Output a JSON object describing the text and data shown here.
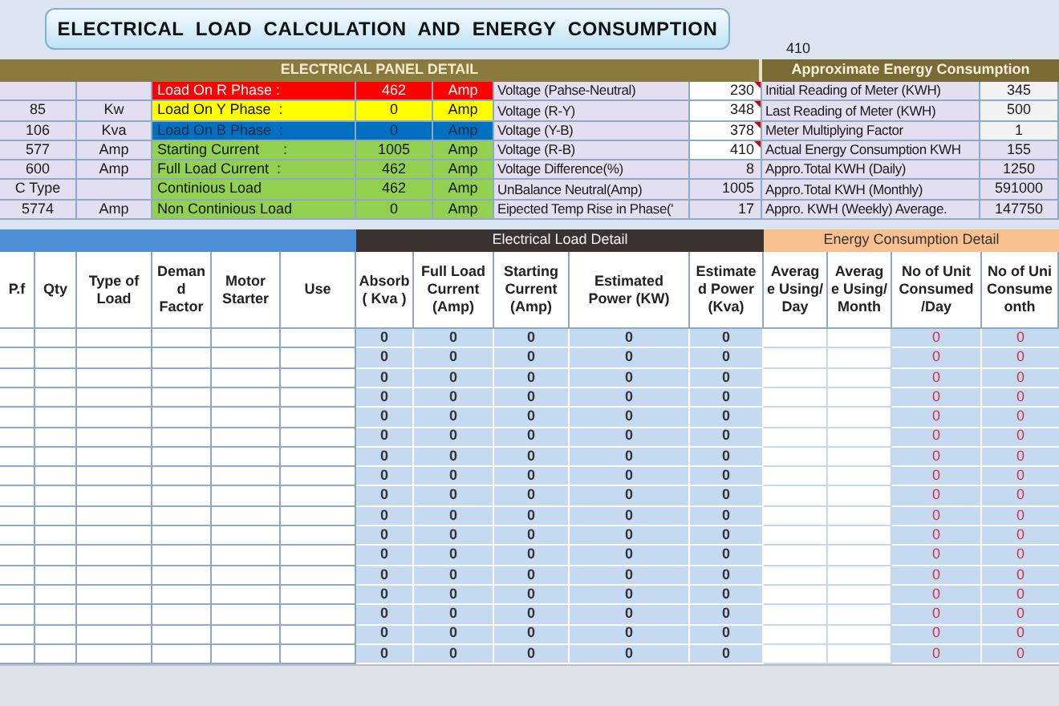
{
  "title": "ELECTRICAL  LOAD  CALCULATION  AND  ENERGY  CONSUMPTION",
  "floating_value": "410",
  "panel": {
    "heading": "ELECTRICAL PANEL DETAIL",
    "energy_heading": "Approximate Energy Consumption",
    "rows": [
      {
        "col_a": null,
        "col_b": null,
        "label": "Load On R Phase :",
        "value": "462",
        "unit": "Amp",
        "color": "#ff0000",
        "voltage_label": "Voltage (Pahse-Neutral)",
        "voltage_value": "230",
        "voltage_input": true,
        "energy_label": "Initial Reading of Meter (KWH)",
        "energy_value": "345",
        "energy_input": true
      },
      {
        "col_a": "85",
        "col_b": "Kw",
        "label": "Load On Y Phase  :",
        "value": "0",
        "unit": "Amp",
        "color": "#ffff00",
        "voltage_label": "Voltage (R-Y)",
        "voltage_value": "348",
        "voltage_input": true,
        "energy_label": "Last Reading of Meter (KWH)",
        "energy_value": "500",
        "energy_input": true
      },
      {
        "col_a": "106",
        "col_b": "Kva",
        "label": "Load On B Phase  :",
        "value": "0",
        "unit": "Amp",
        "color": "#0070c0",
        "voltage_label": "Voltage (Y-B)",
        "voltage_value": "378",
        "voltage_input": true,
        "energy_label": "Meter Multiplying Factor",
        "energy_value": "1",
        "energy_input": true
      },
      {
        "col_a": "577",
        "col_b": "Amp",
        "label": "Starting Current      :",
        "value": "1005",
        "unit": "Amp",
        "color": "#92d050",
        "voltage_label": "Voltage (R-B)",
        "voltage_value": "410",
        "voltage_input": true,
        "energy_label": "Actual Energy Consumption KWH",
        "energy_value": "155",
        "energy_input": false
      },
      {
        "col_a": "600",
        "col_b": "Amp",
        "label": "Full Load Current  :",
        "value": "462",
        "unit": "Amp",
        "color": "#92d050",
        "voltage_label": "Voltage Difference(%)",
        "voltage_value": "8",
        "voltage_input": false,
        "energy_label": "Appro.Total KWH (Daily)",
        "energy_value": "1250",
        "energy_input": false
      },
      {
        "col_a": "C Type",
        "col_b": null,
        "label": "Continious Load",
        "value": "462",
        "unit": "Amp",
        "color": "#92d050",
        "voltage_label": "UnBalance Neutral(Amp)",
        "voltage_value": "1005",
        "voltage_input": false,
        "energy_label": "Appro.Total KWH (Monthly)",
        "energy_value": "591000",
        "energy_input": false
      },
      {
        "col_a": "5774",
        "col_b": "Amp",
        "label": "Non Continious Load",
        "value": "0",
        "unit": "Amp",
        "color": "#92d050",
        "voltage_label": "Eipected Temp Rise in Phase('",
        "voltage_value": "17",
        "voltage_input": false,
        "energy_label": "Appro. KWH (Weekly) Average.",
        "energy_value": "147750",
        "energy_input": false
      }
    ]
  },
  "table": {
    "group_headings": [
      "Electrical Load Detail",
      "Energy Consumption Detail"
    ],
    "columns": [
      "P.f",
      "Qty",
      "Type of Load",
      "Deman d Factor",
      "Motor Starter",
      "Use",
      "Absorb ( Kva )",
      "Full Load Current (Amp)",
      "Starting Current (Amp)",
      "Estimated Power (KW)",
      "Estimate d Power (Kva)",
      "Averag e Using/ Day",
      "Averag e Using/ Month",
      "No of Unit Consumed /Day",
      "No of Uni Consume onth"
    ],
    "rows": [
      {
        "absorb": "0",
        "full_load": "0",
        "starting": "0",
        "power_kw": "0",
        "power_kva": "0",
        "units_day": "0",
        "units_month": "0"
      },
      {
        "absorb": "0",
        "full_load": "0",
        "starting": "0",
        "power_kw": "0",
        "power_kva": "0",
        "units_day": "0",
        "units_month": "0"
      },
      {
        "absorb": "0",
        "full_load": "0",
        "starting": "0",
        "power_kw": "0",
        "power_kva": "0",
        "units_day": "0",
        "units_month": "0"
      },
      {
        "absorb": "0",
        "full_load": "0",
        "starting": "0",
        "power_kw": "0",
        "power_kva": "0",
        "units_day": "0",
        "units_month": "0"
      },
      {
        "absorb": "0",
        "full_load": "0",
        "starting": "0",
        "power_kw": "0",
        "power_kva": "0",
        "units_day": "0",
        "units_month": "0"
      },
      {
        "absorb": "0",
        "full_load": "0",
        "starting": "0",
        "power_kw": "0",
        "power_kva": "0",
        "units_day": "0",
        "units_month": "0"
      },
      {
        "absorb": "0",
        "full_load": "0",
        "starting": "0",
        "power_kw": "0",
        "power_kva": "0",
        "units_day": "0",
        "units_month": "0"
      },
      {
        "absorb": "0",
        "full_load": "0",
        "starting": "0",
        "power_kw": "0",
        "power_kva": "0",
        "units_day": "0",
        "units_month": "0"
      },
      {
        "absorb": "0",
        "full_load": "0",
        "starting": "0",
        "power_kw": "0",
        "power_kva": "0",
        "units_day": "0",
        "units_month": "0"
      },
      {
        "absorb": "0",
        "full_load": "0",
        "starting": "0",
        "power_kw": "0",
        "power_kva": "0",
        "units_day": "0",
        "units_month": "0"
      },
      {
        "absorb": "0",
        "full_load": "0",
        "starting": "0",
        "power_kw": "0",
        "power_kva": "0",
        "units_day": "0",
        "units_month": "0"
      },
      {
        "absorb": "0",
        "full_load": "0",
        "starting": "0",
        "power_kw": "0",
        "power_kva": "0",
        "units_day": "0",
        "units_month": "0"
      },
      {
        "absorb": "0",
        "full_load": "0",
        "starting": "0",
        "power_kw": "0",
        "power_kva": "0",
        "units_day": "0",
        "units_month": "0"
      },
      {
        "absorb": "0",
        "full_load": "0",
        "starting": "0",
        "power_kw": "0",
        "power_kva": "0",
        "units_day": "0",
        "units_month": "0"
      },
      {
        "absorb": "0",
        "full_load": "0",
        "starting": "0",
        "power_kw": "0",
        "power_kva": "0",
        "units_day": "0",
        "units_month": "0"
      },
      {
        "absorb": "0",
        "full_load": "0",
        "starting": "0",
        "power_kw": "0",
        "power_kva": "0",
        "units_day": "0",
        "units_month": "0"
      },
      {
        "absorb": "0",
        "full_load": "0",
        "starting": "0",
        "power_kw": "0",
        "power_kva": "0",
        "units_day": "0",
        "units_month": "0"
      }
    ]
  }
}
